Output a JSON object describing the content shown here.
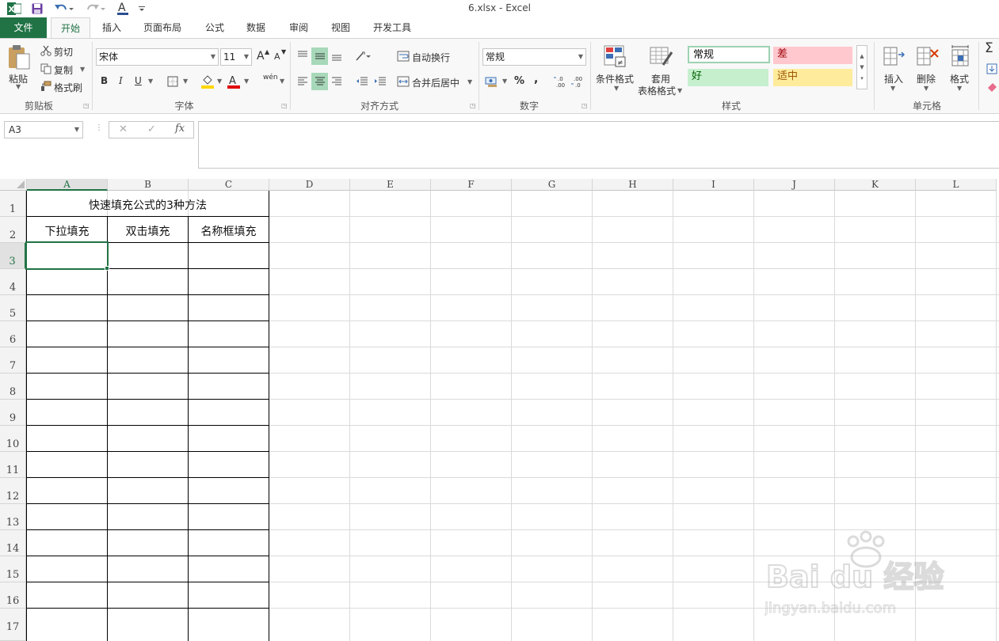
{
  "window": {
    "title": "6.xlsx - Excel"
  },
  "tabs": [
    {
      "label": "文件"
    },
    {
      "label": "开始"
    },
    {
      "label": "插入"
    },
    {
      "label": "页面布局"
    },
    {
      "label": "公式"
    },
    {
      "label": "数据"
    },
    {
      "label": "审阅"
    },
    {
      "label": "视图"
    },
    {
      "label": "开发工具"
    }
  ],
  "ribbon": {
    "clipboard": {
      "group_label": "剪贴板",
      "paste": "粘贴",
      "cut": "剪切",
      "copy": "复制",
      "format_painter": "格式刷"
    },
    "font": {
      "group_label": "字体",
      "font_name": "宋体",
      "font_size": "11",
      "bold": "B",
      "italic": "I",
      "underline": "U",
      "font_color_glyph": "A",
      "grow_glyph": "A",
      "shrink_glyph": "A",
      "phonetic": "wén"
    },
    "alignment": {
      "group_label": "对齐方式",
      "wrap_text": "自动换行",
      "merge_center": "合并后居中"
    },
    "number": {
      "group_label": "数字",
      "format": "常规",
      "percent": "%",
      "comma": ",",
      "inc_decimal": ".0\n.00",
      "dec_decimal": ".00\n.0"
    },
    "styles": {
      "group_label": "样式",
      "conditional_format": "条件格式",
      "table_format_1": "套用",
      "table_format_2": "表格格式",
      "normal": "常规",
      "bad": "差",
      "good": "好",
      "neutral": "适中",
      "colors": {
        "normal_border": "#9dd2b1",
        "bad_bg": "#ffc7ce",
        "bad_fg": "#9c0006",
        "good_bg": "#c6efce",
        "good_fg": "#006100",
        "neutral_bg": "#ffeb9c",
        "neutral_fg": "#9c5700"
      }
    },
    "cells": {
      "group_label": "单元格",
      "insert": "插入",
      "delete": "删除",
      "format": "格式"
    },
    "editing": {
      "sum_glyph": "Σ"
    }
  },
  "formula_bar": {
    "name_box": "A3",
    "cancel": "✕",
    "enter": "✓",
    "fx": "fx",
    "value": ""
  },
  "sheet": {
    "columns": [
      "A",
      "B",
      "C",
      "D",
      "E",
      "F",
      "G",
      "H",
      "I",
      "J",
      "K",
      "L"
    ],
    "rows": [
      "1",
      "2",
      "3",
      "4",
      "5",
      "6",
      "7",
      "8",
      "9",
      "10",
      "11",
      "12",
      "13",
      "14",
      "15",
      "16",
      "17"
    ],
    "selected_cell": "A3",
    "title": "快速填充公式的3种方法",
    "headers": [
      "下拉填充",
      "双击填充",
      "名称框填充"
    ]
  },
  "watermark": {
    "brand": "Bai du 经验",
    "url": "jingyan.baidu.com"
  },
  "accent_color": "#217346"
}
